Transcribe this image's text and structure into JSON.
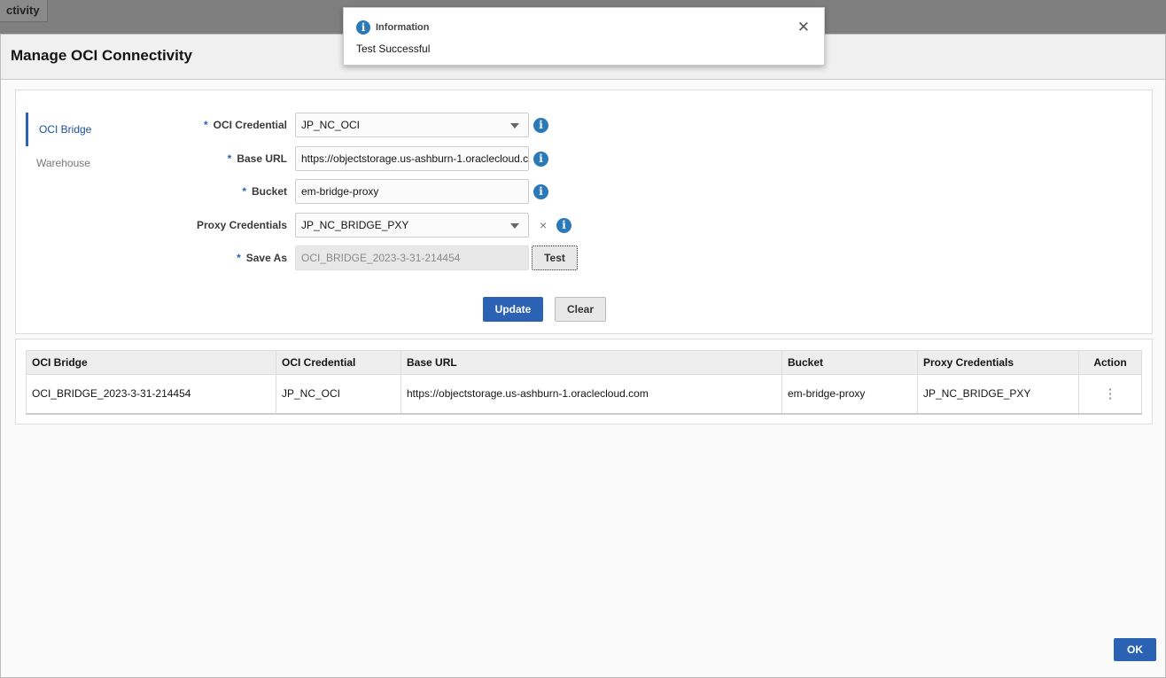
{
  "background": {
    "tab_label": "ctivity"
  },
  "dialog": {
    "title": "Manage OCI Connectivity",
    "ok_label": "OK"
  },
  "nav": [
    {
      "label": "OCI Bridge",
      "active": true
    },
    {
      "label": "Warehouse",
      "active": false
    }
  ],
  "form": {
    "oci_credential": {
      "label": "OCI Credential",
      "value": "JP_NC_OCI"
    },
    "base_url": {
      "label": "Base URL",
      "value": "https://objectstorage.us-ashburn-1.oraclecloud.com"
    },
    "bucket": {
      "label": "Bucket",
      "value": "em-bridge-proxy"
    },
    "proxy_credentials": {
      "label": "Proxy Credentials",
      "value": "JP_NC_BRIDGE_PXY",
      "clear": "×"
    },
    "save_as": {
      "label": "Save As",
      "value": "OCI_BRIDGE_2023-3-31-214454"
    },
    "required_mark": "*",
    "info_glyph": "i",
    "test_label": "Test",
    "update_label": "Update",
    "clear_label": "Clear"
  },
  "table": {
    "headers": [
      "OCI Bridge",
      "OCI Credential",
      "Base URL",
      "Bucket",
      "Proxy Credentials",
      "Action"
    ],
    "rows": [
      [
        "OCI_BRIDGE_2023-3-31-214454",
        "JP_NC_OCI",
        "https://objectstorage.us-ashburn-1.oraclecloud.com",
        "em-bridge-proxy",
        "JP_NC_BRIDGE_PXY",
        "⋮"
      ]
    ]
  },
  "toast": {
    "title": "Information",
    "message": "Test Successful",
    "close": "✕"
  },
  "colors": {
    "accent": "#2b62b4",
    "info": "#2c79b8"
  }
}
